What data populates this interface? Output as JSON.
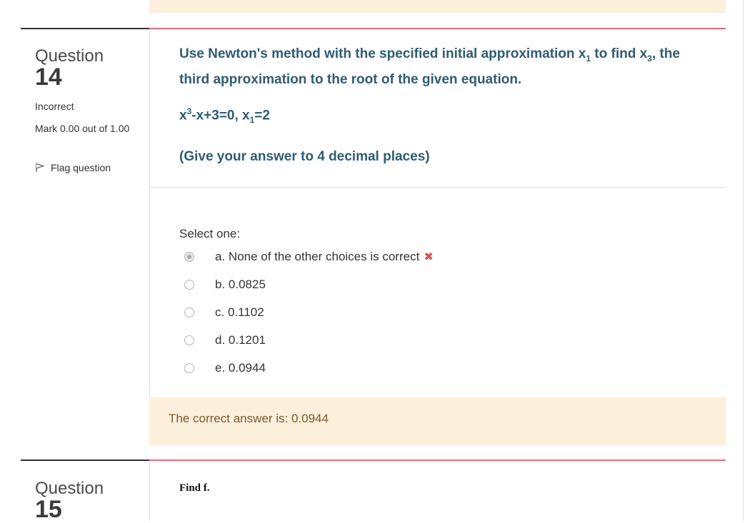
{
  "question14": {
    "word": "Question",
    "number": "14",
    "state": "Incorrect",
    "grade": "Mark 0.00 out of 1.00",
    "flag_label": "Flag question",
    "prompt_line1_a": "Use Newton's method with the specified initial approximation x",
    "prompt_line1_sub": "1",
    "prompt_line1_b": " to find x",
    "prompt_line1_sub2": "3",
    "prompt_line1_c": ", the",
    "prompt_line2": "third approximation to the root of the given equation.",
    "eq_a": "x",
    "eq_sup": "3",
    "eq_b": "-x+3=0, x",
    "eq_sub": "1",
    "eq_c": "=2",
    "note": "(Give your answer to 4 decimal places)",
    "select_label": "Select one:",
    "options": [
      {
        "label": "a. None of the other choices is correct",
        "checked": true,
        "marked_incorrect": true
      },
      {
        "label": "b. 0.0825",
        "checked": false
      },
      {
        "label": "c. 0.1102",
        "checked": false
      },
      {
        "label": "d. 0.1201",
        "checked": false
      },
      {
        "label": "e. 0.0944",
        "checked": false
      }
    ],
    "correct_answer": "The correct answer is: 0.0944"
  },
  "question15": {
    "word": "Question",
    "number": "15",
    "text": "Find f."
  },
  "colors": {
    "accent_rule": "#e96b7a",
    "feedback_bg": "#fcefdc",
    "question_text": "#2f5c72",
    "incorrect_mark": "#d9534f"
  }
}
